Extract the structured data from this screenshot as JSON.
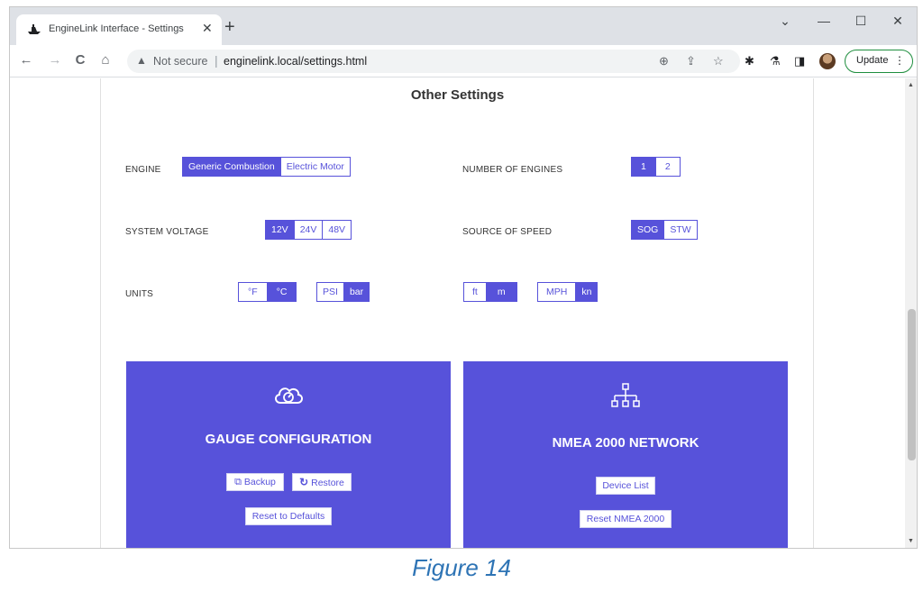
{
  "browser": {
    "tab_title": "EngineLink Interface - Settings",
    "tab_close": "✕",
    "new_tab": "+",
    "controls": {
      "dropdown": "⌄",
      "minimize": "—",
      "maximize": "☐",
      "close": "✕"
    },
    "nav": {
      "back": "←",
      "forward": "→",
      "reload": "C",
      "home": "⌂"
    },
    "address": {
      "warning": "▲",
      "security": "Not secure",
      "separator": "|",
      "url": "enginelink.local/settings.html"
    },
    "update_label": "Update",
    "update_menu": "⋮",
    "icons": {
      "zoom": "⊕",
      "share": "⇪",
      "bookmark": "☆",
      "extensions": "✱",
      "labs": "⚗",
      "sidepanel": "◨"
    }
  },
  "settings": {
    "title": "Other Settings",
    "engine": {
      "label": "ENGINE",
      "options": [
        "Generic Combustion",
        "Electric Motor"
      ],
      "selected": 0
    },
    "num_engines": {
      "label": "NUMBER OF ENGINES",
      "options": [
        "1",
        "2"
      ],
      "selected": 0
    },
    "voltage": {
      "label": "SYSTEM VOLTAGE",
      "options": [
        "12V",
        "24V",
        "48V"
      ],
      "selected": 0
    },
    "speed_source": {
      "label": "SOURCE OF SPEED",
      "options": [
        "SOG",
        "STW"
      ],
      "selected": 0
    },
    "units": {
      "label": "UNITS",
      "temperature": {
        "options": [
          "°F",
          "°C"
        ],
        "selected": 1
      },
      "pressure": {
        "options": [
          "PSI",
          "bar"
        ],
        "selected": 1
      },
      "depth": {
        "options": [
          "ft",
          "m"
        ],
        "selected": 1
      },
      "speed": {
        "options": [
          "MPH",
          "kn"
        ],
        "selected": 1
      }
    }
  },
  "gauge_card": {
    "title": "GAUGE CONFIGURATION",
    "backup_label": "Backup",
    "restore_label": "Restore",
    "reset_label": "Reset to Defaults"
  },
  "nmea_card": {
    "title": "NMEA 2000 NETWORK",
    "device_list_label": "Device List",
    "reset_label": "Reset NMEA 2000"
  },
  "scrollbar": {
    "up": "▲",
    "down": "▼"
  },
  "caption": "Figure 14",
  "colors": {
    "accent": "#5752da",
    "browser_frame": "#dee1e6",
    "caption": "#2e74b5"
  }
}
